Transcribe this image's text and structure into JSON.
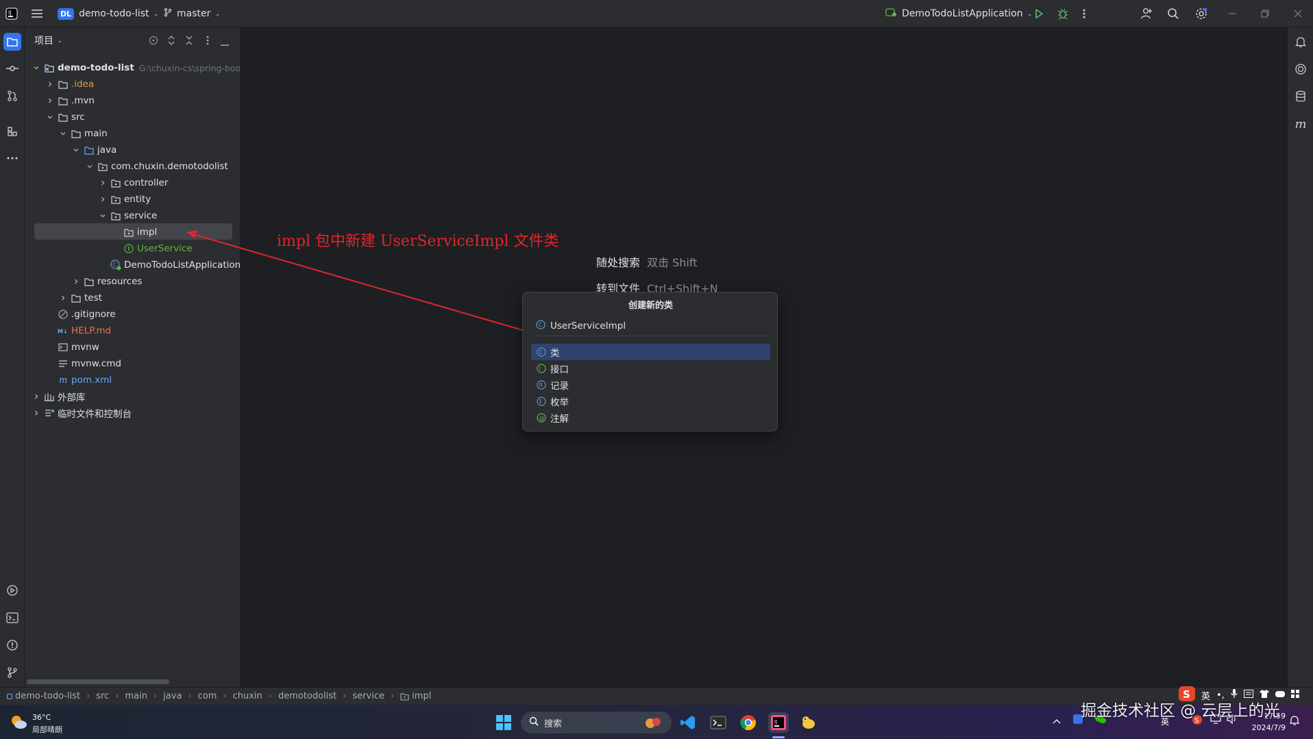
{
  "titlebar": {
    "project_badge": "DL",
    "project_name": "demo-todo-list",
    "branch": "master",
    "run_config": "DemoTodoListApplication"
  },
  "project_panel": {
    "title": "项目",
    "tree": [
      {
        "label": "demo-todo-list",
        "path": "G:\\chuxin-cs\\spring-boo",
        "color": "#dfe1e5",
        "bold": true
      },
      {
        "label": ".idea",
        "color": "#d6a14a"
      },
      {
        "label": ".mvn",
        "color": "#dfe1e5"
      },
      {
        "label": "src",
        "color": "#dfe1e5"
      },
      {
        "label": "main",
        "color": "#dfe1e5"
      },
      {
        "label": "java",
        "color": "#dfe1e5"
      },
      {
        "label": "com.chuxin.demotodolist",
        "color": "#dfe1e5"
      },
      {
        "label": "controller",
        "color": "#dfe1e5"
      },
      {
        "label": "entity",
        "color": "#dfe1e5"
      },
      {
        "label": "service",
        "color": "#dfe1e5"
      },
      {
        "label": "impl",
        "color": "#dfe1e5"
      },
      {
        "label": "UserService",
        "color": "#62b543"
      },
      {
        "label": "DemoTodoListApplication",
        "color": "#dfe1e5"
      },
      {
        "label": "resources",
        "color": "#dfe1e5"
      },
      {
        "label": "test",
        "color": "#dfe1e5"
      },
      {
        "label": ".gitignore",
        "color": "#dfe1e5"
      },
      {
        "label": "HELP.md",
        "color": "#e8734a"
      },
      {
        "label": "mvnw",
        "color": "#dfe1e5"
      },
      {
        "label": "mvnw.cmd",
        "color": "#dfe1e5"
      },
      {
        "label": "pom.xml",
        "color": "#6fa8f5"
      },
      {
        "label": "外部库",
        "color": "#dfe1e5"
      },
      {
        "label": "临时文件和控制台",
        "color": "#dfe1e5"
      }
    ]
  },
  "editor_hints": {
    "search_label": "随处搜索",
    "search_key": "双击 Shift",
    "goto_label": "转到文件",
    "goto_key": "Ctrl+Shift+N"
  },
  "annotation": {
    "text": "impl 包中新建 UserServiceImpl 文件类",
    "color": "#e0262b"
  },
  "new_class_popup": {
    "title": "创建新的类",
    "name_value": "UserServiceImpl",
    "options": [
      {
        "label": "类",
        "icon_letter": "C",
        "icon_color": "#5b9bd5",
        "selected": true
      },
      {
        "label": "接口",
        "icon_letter": "I",
        "icon_color": "#62b543",
        "selected": false
      },
      {
        "label": "记录",
        "icon_letter": "R",
        "icon_color": "#5b9bd5",
        "selected": false
      },
      {
        "label": "枚举",
        "icon_letter": "E",
        "icon_color": "#5b9bd5",
        "selected": false
      },
      {
        "label": "注解",
        "icon_letter": "@",
        "icon_color": "#62b543",
        "selected": false
      }
    ],
    "selected_bg": "#2e436e"
  },
  "breadcrumb": [
    "demo-todo-list",
    "src",
    "main",
    "java",
    "com",
    "chuxin",
    "demotodolist",
    "service",
    "impl"
  ],
  "taskbar": {
    "weather_temp": "36°C",
    "weather_desc": "局部晴朗",
    "search_placeholder": "搜索",
    "ime_lang": "英",
    "time": "17:59",
    "date": "2024/7/9"
  },
  "watermark": "掘金技术社区 @ 云层上的光"
}
